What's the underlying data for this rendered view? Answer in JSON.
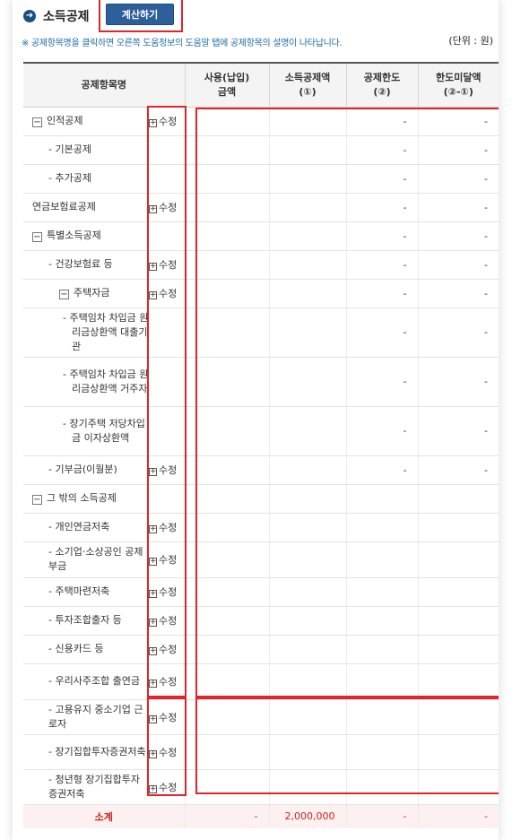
{
  "header": {
    "title": "소득공제",
    "calc_button": "계산하기",
    "notice": "※ 공제항목명을 클릭하면 오른쪽 도움정보의 도움말 탭에 공제항목의 설명이 나타납니다.",
    "unit": "(단위 : 원)"
  },
  "table": {
    "columns": [
      "공제항목명",
      "사용(납입)\n금액",
      "소득공제액\n(①)",
      "공제한도\n(②)",
      "한도미달액\n(②-①)"
    ],
    "edit_label": "수정",
    "rows": [
      {
        "name": "인적공제",
        "level": 0,
        "toggle": "−",
        "edit": true,
        "limit": "-",
        "shortfall": "-",
        "h": 32
      },
      {
        "name": "- 기본공제",
        "level": 1,
        "toggle": "",
        "edit": false,
        "limit": "-",
        "shortfall": "-",
        "h": 32
      },
      {
        "name": "- 추가공제",
        "level": 1,
        "toggle": "",
        "edit": false,
        "limit": "-",
        "shortfall": "-",
        "h": 32
      },
      {
        "name": "연금보험료공제",
        "level": 0,
        "toggle": "",
        "edit": true,
        "limit": "-",
        "shortfall": "-",
        "h": 32
      },
      {
        "name": "특별소득공제",
        "level": 0,
        "toggle": "−",
        "edit": false,
        "limit": "-",
        "shortfall": "-",
        "h": 32
      },
      {
        "name": "- 건강보험료 등",
        "level": 1,
        "toggle": "",
        "edit": true,
        "limit": "-",
        "shortfall": "-",
        "h": 32
      },
      {
        "name": "주택자금",
        "level": 2,
        "toggle": "−",
        "edit": true,
        "limit": "-",
        "shortfall": "-",
        "h": 32
      },
      {
        "name": "- 주택임차 차입금 원리금상환액 대출기관",
        "level": 3,
        "toggle": "",
        "edit": false,
        "limit": "-",
        "shortfall": "-",
        "h": 55
      },
      {
        "name": "- 주택임차 차입금 원리금상환액 거주자",
        "level": 3,
        "toggle": "",
        "edit": false,
        "limit": "-",
        "shortfall": "-",
        "h": 55
      },
      {
        "name": "- 장기주택 저당차입금 이자상환액",
        "level": 3,
        "toggle": "",
        "edit": false,
        "limit": "-",
        "shortfall": "-",
        "h": 55
      },
      {
        "name": "- 기부금(이월분)",
        "level": 1,
        "toggle": "",
        "edit": true,
        "limit": "-",
        "shortfall": "-",
        "h": 32
      },
      {
        "name": "그 밖의 소득공제",
        "level": 0,
        "toggle": "−",
        "edit": false,
        "limit": "",
        "shortfall": "",
        "h": 32
      },
      {
        "name": "- 개인연금저축",
        "level": 1,
        "toggle": "",
        "edit": true,
        "limit": "",
        "shortfall": "",
        "h": 32
      },
      {
        "name": "- 소기업·소상공인 공제부금",
        "level": 1,
        "toggle": "",
        "edit": true,
        "limit": "",
        "shortfall": "",
        "h": 40
      },
      {
        "name": "- 주택마련저축",
        "level": 1,
        "toggle": "",
        "edit": true,
        "limit": "",
        "shortfall": "",
        "h": 32
      },
      {
        "name": "- 투자조합출자 등",
        "level": 1,
        "toggle": "",
        "edit": true,
        "limit": "",
        "shortfall": "",
        "h": 32
      },
      {
        "name": "- 신용카드 등",
        "level": 1,
        "toggle": "",
        "edit": true,
        "limit": "",
        "shortfall": "",
        "h": 32
      },
      {
        "name": "- 우리사주조합 출연금",
        "level": 1,
        "toggle": "",
        "edit": true,
        "limit": "",
        "shortfall": "",
        "h": 40
      },
      {
        "name": "- 고용유지 중소기업 근로자",
        "level": 1,
        "toggle": "",
        "edit": true,
        "limit": "",
        "shortfall": "",
        "h": 39
      },
      {
        "name": "- 장기집합투자증권저축",
        "level": 1,
        "toggle": "",
        "edit": true,
        "limit": "",
        "shortfall": "",
        "h": 39
      },
      {
        "name": "- 청년형 장기집합투자증권저축",
        "level": 1,
        "toggle": "",
        "edit": true,
        "limit": "",
        "shortfall": "",
        "h": 39
      }
    ],
    "total": {
      "label": "소계",
      "paid": "-",
      "deduction": "2,000,000",
      "limit": "-",
      "shortfall": "-"
    }
  },
  "colors": {
    "accent": "#2d5f9a",
    "highlight": "#e0242b",
    "notice": "#1e6ba8",
    "total_bg": "#fdf0f0"
  }
}
